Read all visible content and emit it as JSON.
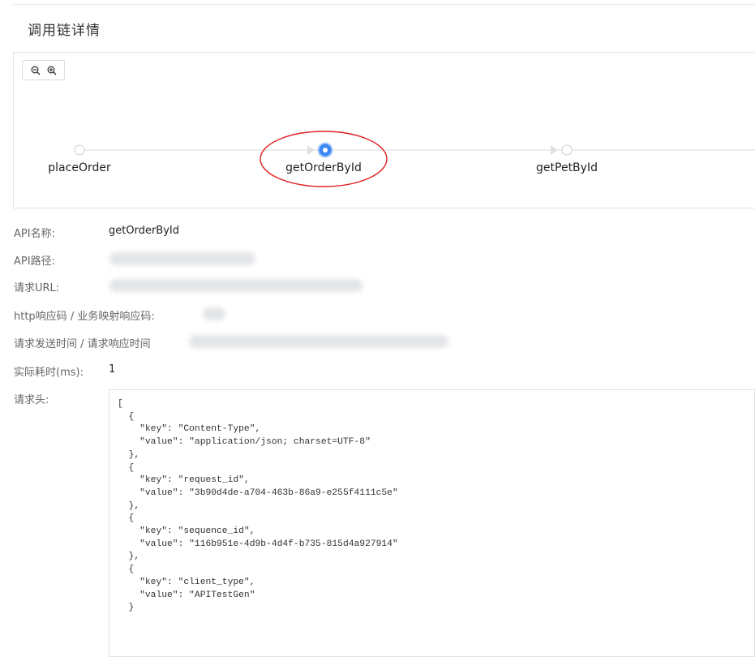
{
  "page": {
    "title": "调用链详情"
  },
  "toolbar": {
    "zoom_out_icon": "zoom-out-icon",
    "zoom_in_icon": "zoom-in-icon"
  },
  "call_chain": {
    "nodes": [
      {
        "label": "placeOrder",
        "state": "normal"
      },
      {
        "label": "getOrderById",
        "state": "selected"
      },
      {
        "label": "getPetById",
        "state": "normal"
      }
    ],
    "colors": {
      "selected": "#3b87f5",
      "connector": "#d9d9d9",
      "highlight_ring": "#e02020"
    }
  },
  "details": {
    "api_name": {
      "label": "API名称:",
      "value": "getOrderById"
    },
    "api_path": {
      "label": "API路径:"
    },
    "request_url": {
      "label": "请求URL:"
    },
    "response_codes": {
      "label": "http响应码 / 业务映射响应码:"
    },
    "times": {
      "label": "请求发送时间 / 请求响应时间"
    },
    "elapsed": {
      "label": "实际耗时(ms):",
      "value": "1"
    },
    "headers": {
      "label": "请求头:",
      "content": "[\n  {\n    \"key\": \"Content-Type\",\n    \"value\": \"application/json; charset=UTF-8\"\n  },\n  {\n    \"key\": \"request_id\",\n    \"value\": \"3b90d4de-a704-463b-86a9-e255f4111c5e\"\n  },\n  {\n    \"key\": \"sequence_id\",\n    \"value\": \"116b951e-4d9b-4d4f-b735-815d4a927914\"\n  },\n  {\n    \"key\": \"client_type\",\n    \"value\": \"APITestGen\"\n  }"
    }
  }
}
